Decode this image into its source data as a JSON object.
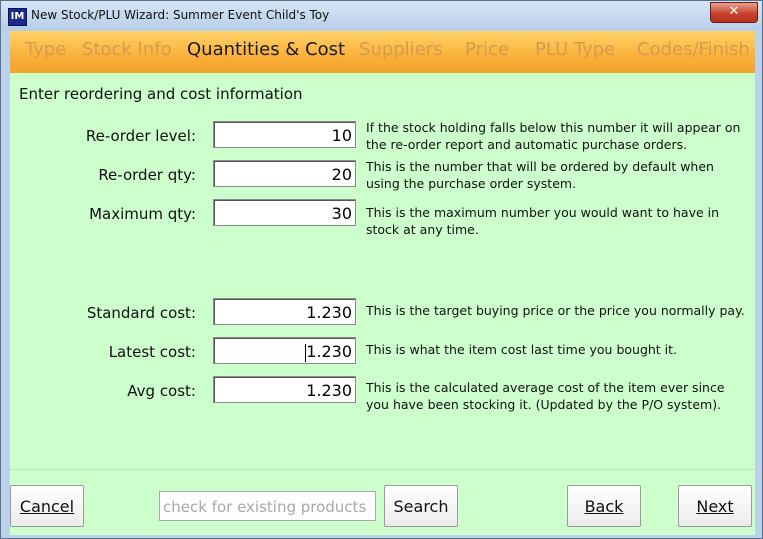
{
  "window": {
    "title": "New Stock/PLU Wizard: Summer Event Child's Toy",
    "app_icon_text": "IM",
    "close_symbol": "✕"
  },
  "tabs": [
    {
      "label": "Type",
      "active": false
    },
    {
      "label": "Stock Info",
      "active": false
    },
    {
      "label": "Quantities & Cost",
      "active": true
    },
    {
      "label": "Suppliers",
      "active": false
    },
    {
      "label": "Price",
      "active": false
    },
    {
      "label": "PLU Type",
      "active": false
    },
    {
      "label": "Codes/Finish",
      "active": false
    }
  ],
  "content": {
    "heading": "Enter reordering and cost information",
    "fields": [
      {
        "label": "Re-order level:",
        "value": "10",
        "help": "If the stock holding falls below this number it will appear on the re-order report and automatic purchase orders."
      },
      {
        "label": "Re-order qty:",
        "value": "20",
        "help": "This is the number that will be ordered by default when using the purchase order system."
      },
      {
        "label": "Maximum qty:",
        "value": "30",
        "help": "This is the maximum number you would want to have in stock at any time."
      },
      {
        "label": "Standard cost:",
        "value": "1.230",
        "help": "This is the target buying price or the price you normally pay."
      },
      {
        "label": "Latest cost:",
        "value": "1.230",
        "help": "This is what the item cost last time you bought it."
      },
      {
        "label": "Avg cost:",
        "value": "1.230",
        "help": "This is the calculated average cost of the item ever since you have been stocking it.  (Updated by the P/O system)."
      }
    ]
  },
  "footer": {
    "cancel_label": "Cancel",
    "search_placeholder": "check for existing products",
    "search_label": "Search",
    "back_label": "Back",
    "next_label": "Next"
  },
  "colors": {
    "tab_gradient": "#f9b03a",
    "content_bg": "#ccffcc",
    "close_button": "#c7432e"
  }
}
